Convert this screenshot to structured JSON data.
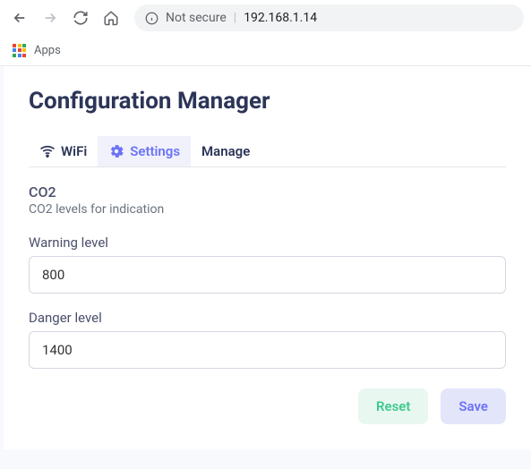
{
  "browser": {
    "security_label": "Not secure",
    "url": "192.168.1.14",
    "apps_label": "Apps"
  },
  "page": {
    "title": "Configuration Manager"
  },
  "tabs": {
    "wifi": "WiFi",
    "settings": "Settings",
    "manage": "Manage"
  },
  "section": {
    "title": "CO2",
    "subtitle": "CO2 levels for indication"
  },
  "fields": {
    "warning": {
      "label": "Warning level",
      "value": "800"
    },
    "danger": {
      "label": "Danger level",
      "value": "1400"
    }
  },
  "buttons": {
    "reset": "Reset",
    "save": "Save"
  }
}
